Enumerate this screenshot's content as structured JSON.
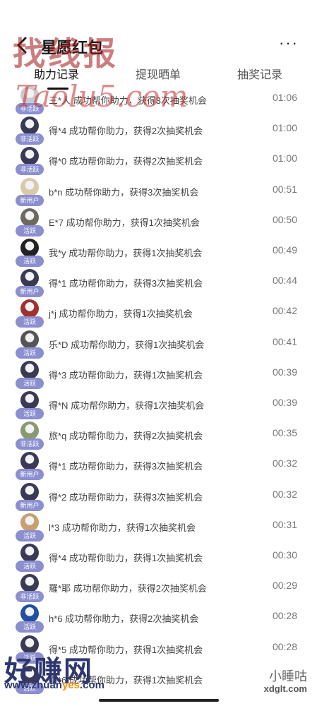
{
  "header": {
    "title": "星愿红包",
    "more": "···"
  },
  "tabs": [
    "助力记录",
    "提现晒单",
    "抽奖记录"
  ],
  "active_tab": 0,
  "watermarks": {
    "top": "找线报",
    "taolu": "Taolu5.com",
    "footer_main": "好赚网",
    "footer_url_prefix": "www.zhuan",
    "footer_url_highlight": "yes",
    "footer_url_suffix": ".com",
    "xmt": "小睡咕",
    "site": "xdglt.com"
  },
  "rows": [
    {
      "user": "三*人",
      "badge": "非活跃",
      "text": "成功帮你助力，获得3次抽奖机会",
      "time": "01:06",
      "avatar_color": "#c9c9d0"
    },
    {
      "user": "得*4",
      "badge": "非活跃",
      "text": "成功帮你助力，获得2次抽奖机会",
      "time": "01:00",
      "avatar_color": "#3a3a55"
    },
    {
      "user": "得*0",
      "badge": "非活跃",
      "text": "成功帮你助力，获得2次抽奖机会",
      "time": "01:00",
      "avatar_color": "#3a3a55"
    },
    {
      "user": "b*n",
      "badge": "新用户",
      "text": "成功帮你助力，获得3次抽奖机会",
      "time": "00:51",
      "avatar_color": "#d8c9a8"
    },
    {
      "user": "E*7",
      "badge": "活跃",
      "text": "成功帮你助力，获得1次抽奖机会",
      "time": "00:50",
      "avatar_color": "#6d6860"
    },
    {
      "user": "我*y",
      "badge": "活跃",
      "text": "成功帮你助力，获得1次抽奖机会",
      "time": "00:49",
      "avatar_color": "#222222"
    },
    {
      "user": "得*1",
      "badge": "新用户",
      "text": "成功帮你助力，获得3次抽奖机会",
      "time": "00:44",
      "avatar_color": "#3a3a55"
    },
    {
      "user": "j*j",
      "badge": "活跃",
      "text": "成功帮你助力，获得1次抽奖机会",
      "time": "00:42",
      "avatar_color": "#a03030"
    },
    {
      "user": "乐*D",
      "badge": "活跃",
      "text": "成功帮你助力，获得1次抽奖机会",
      "time": "00:41",
      "avatar_color": "#555555"
    },
    {
      "user": "得*3",
      "badge": "活跃",
      "text": "成功帮你助力，获得1次抽奖机会",
      "time": "00:39",
      "avatar_color": "#3a3a55"
    },
    {
      "user": "得*N",
      "badge": "活跃",
      "text": "成功帮你助力，获得1次抽奖机会",
      "time": "00:39",
      "avatar_color": "#3a3a55"
    },
    {
      "user": "旅*q",
      "badge": "非活跃",
      "text": "成功帮你助力，获得2次抽奖机会",
      "time": "00:35",
      "avatar_color": "#8a9a70"
    },
    {
      "user": "得*1",
      "badge": "新用户",
      "text": "成功帮你助力，获得3次抽奖机会",
      "time": "00:32",
      "avatar_color": "#3a3a55"
    },
    {
      "user": "得*2",
      "badge": "新用户",
      "text": "成功帮你助力，获得3次抽奖机会",
      "time": "00:32",
      "avatar_color": "#3a3a55"
    },
    {
      "user": "l*3",
      "badge": "活跃",
      "text": "成功帮你助力，获得1次抽奖机会",
      "time": "00:31",
      "avatar_color": "#c8a070"
    },
    {
      "user": "得*4",
      "badge": "活跃",
      "text": "成功帮你助力，获得1次抽奖机会",
      "time": "00:30",
      "avatar_color": "#3a3a55"
    },
    {
      "user": "羅*耶",
      "badge": "非活跃",
      "text": "成功帮你助力，获得2次抽奖机会",
      "time": "00:29",
      "avatar_color": "#3a3a55"
    },
    {
      "user": "h*6",
      "badge": "活跃",
      "text": "成功帮你助力，获得2次抽奖机会",
      "time": "00:28",
      "avatar_color": "#2050a0"
    },
    {
      "user": "得*5",
      "badge": "活跃",
      "text": "成功帮你助力，获得1次抽奖机会",
      "time": "00:28",
      "avatar_color": "#3a3a55"
    },
    {
      "user": "得*6",
      "badge": "活跃",
      "text": "成功帮你助力，获得1次抽奖机会",
      "time": "",
      "avatar_color": "#3a3a55"
    }
  ]
}
